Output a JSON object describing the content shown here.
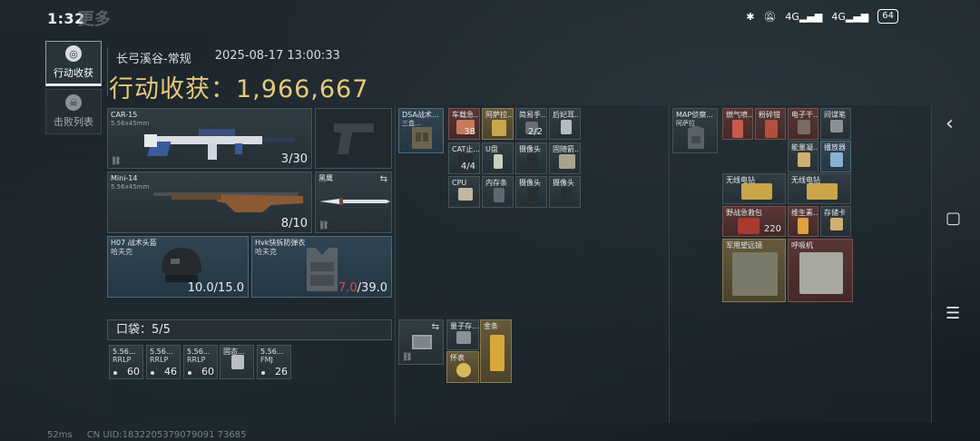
{
  "status_bar": {
    "time": "1:32",
    "ghost_text": "更多",
    "network1": "4G",
    "network2": "4G",
    "battery": "64"
  },
  "nav": {
    "tab_active": "行动收获",
    "tab_inactive": "击败列表"
  },
  "header": {
    "map_mode": "长弓溪谷-常规",
    "datetime": "2025-08-17 13:00:33",
    "title_label": "行动收获：",
    "title_value": "1,966,667"
  },
  "weapons": {
    "primary1": {
      "name": "CAR-15",
      "caliber": "5.56x45mm",
      "ammo": "3/30"
    },
    "primary2": {
      "name": "Mini-14",
      "caliber": "5.56x45mm",
      "ammo": "8/10"
    },
    "melee": {
      "name": "黑鹰"
    },
    "helmet": {
      "name": "H07 战术头盔",
      "brand": "哈夫克",
      "durability": "10.0/15.0"
    },
    "armor": {
      "name": "Hvk快拆防弹衣",
      "brand": "哈夫克",
      "durability_current": "7.0",
      "durability_max": "/39.0"
    }
  },
  "pocket": {
    "label": "口袋：5/5"
  },
  "pocket_items": [
    {
      "name": "5.56...",
      "sub": "RRLP",
      "count": "60"
    },
    {
      "name": "5.56...",
      "sub": "RRLP",
      "count": "46"
    },
    {
      "name": "5.56...",
      "sub": "RRLP",
      "count": "60"
    },
    {
      "name": "固态...",
      "sub": "",
      "count": ""
    },
    {
      "name": "5.56...",
      "sub": "FMJ",
      "count": "26"
    }
  ],
  "chest_rig": {
    "name": "DSA战术...",
    "sub": "三盒..."
  },
  "rig_items": [
    {
      "name": "车载急...",
      "count": "38"
    },
    {
      "name": "阿萨拉...",
      "count": ""
    },
    {
      "name": "简易手...",
      "count": "2/2"
    },
    {
      "name": "后妃耳...",
      "count": ""
    },
    {
      "name": "CAT止...",
      "count": "4/4"
    },
    {
      "name": "U盘",
      "count": ""
    },
    {
      "name": "摄像头",
      "count": ""
    },
    {
      "name": "固随箭...",
      "count": ""
    },
    {
      "name": "CPU",
      "count": ""
    },
    {
      "name": "内存条",
      "count": ""
    },
    {
      "name": "摄像头",
      "count": ""
    },
    {
      "name": "摄像头",
      "count": ""
    }
  ],
  "case_items": [
    {
      "name": "量子存...",
      "count": ""
    },
    {
      "name": "金条",
      "count": ""
    },
    {
      "name": "怀表",
      "count": ""
    }
  ],
  "backpack": {
    "name": "MAP侦察...",
    "sub": "阿萨拉"
  },
  "backpack_items": [
    {
      "name": "燃气喷..."
    },
    {
      "name": "粉碎钳"
    },
    {
      "name": "电子干..."
    },
    {
      "name": "间谍笔"
    },
    {
      "name": "能量凝..."
    },
    {
      "name": "播放器"
    },
    {
      "name": "无线电钻"
    },
    {
      "name": "无线电钻"
    },
    {
      "name": "野战急救包",
      "count": "220"
    },
    {
      "name": "维生素..."
    },
    {
      "name": "存储卡"
    },
    {
      "name": "军用望远镜"
    },
    {
      "name": "呼吸机"
    }
  ],
  "footer": {
    "ping": "52ms",
    "uid": "CN UID:1832205379079091 73685"
  },
  "colors": {
    "gold": "#e6c97a",
    "red_item": "#5f3734",
    "gold_item": "#6e5f3c",
    "blue_item": "#32485a"
  }
}
